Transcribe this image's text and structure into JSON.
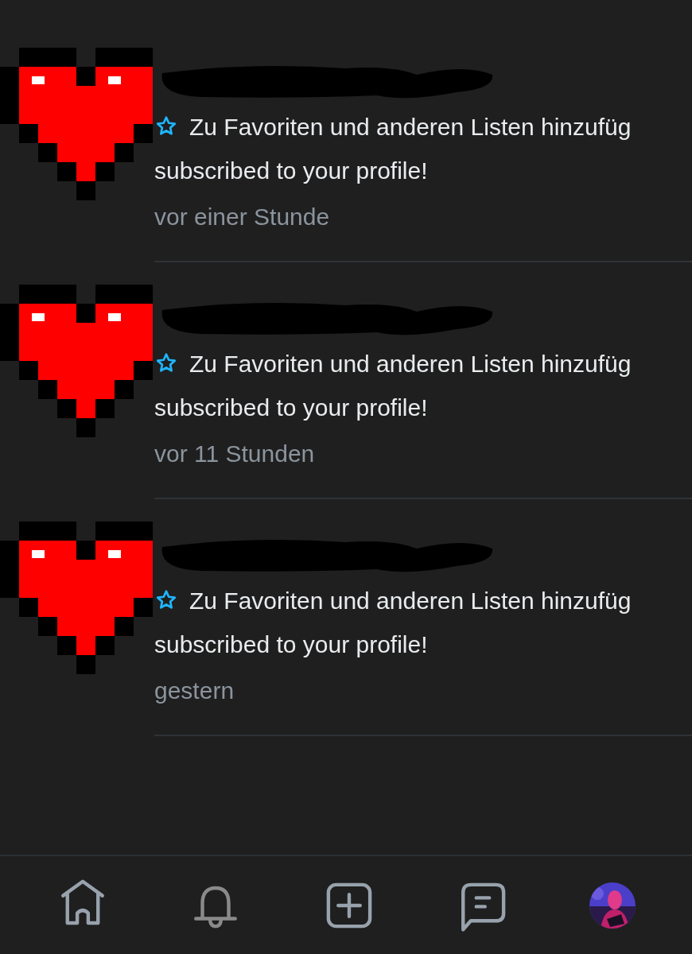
{
  "notifications": [
    {
      "action": "Zu Favoriten und anderen Listen hinzufüg",
      "message": "subscribed to your profile!",
      "time": "vor einer Stunde"
    },
    {
      "action": "Zu Favoriten und anderen Listen hinzufüg",
      "message": "subscribed to your profile!",
      "time": "vor 11 Stunden"
    },
    {
      "action": "Zu Favoriten und anderen Listen hinzufüg",
      "message": "subscribed to your profile!",
      "time": "gestern"
    }
  ],
  "bottom_nav": [
    {
      "kind": "home",
      "selected": false
    },
    {
      "kind": "bell",
      "selected": true
    },
    {
      "kind": "add",
      "selected": false
    },
    {
      "kind": "chat",
      "selected": false
    },
    {
      "kind": "avatar",
      "selected": false
    }
  ]
}
